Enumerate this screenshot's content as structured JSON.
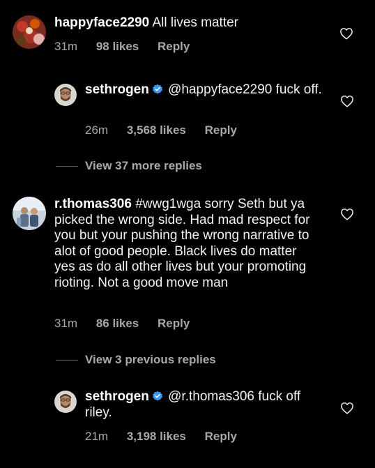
{
  "comments": [
    {
      "username": "happyface2290",
      "text": "All lives matter",
      "time": "31m",
      "likes": "98 likes",
      "reply": "Reply",
      "verified": false
    },
    {
      "username": "sethrogen",
      "text": "@happyface2290 fuck off.",
      "time": "26m",
      "likes": "3,568 likes",
      "reply": "Reply",
      "verified": true
    },
    {
      "username": "r.thomas306",
      "text": "#wwg1wga sorry Seth but ya picked the wrong side. Had mad respect  for you but your pushing the wrong  narrative  to alot of good people. Black lives do matter yes as do all other lives but your  promoting  rioting. Not a good move man",
      "time": "31m",
      "likes": "86 likes",
      "reply": "Reply",
      "verified": false
    },
    {
      "username": "sethrogen",
      "text": "@r.thomas306 fuck off riley.",
      "time": "21m",
      "likes": "3,198 likes",
      "reply": "Reply",
      "verified": true
    }
  ],
  "view_more_1": "View 37 more replies",
  "view_more_2": "View 3 previous replies",
  "colors": {
    "background": "#000000",
    "text": "#f2f2f2",
    "secondary": "#a8a8a8",
    "verified": "#3897f0"
  },
  "icons": {
    "like": "heart-outline-icon",
    "verified": "verified-badge-icon"
  }
}
